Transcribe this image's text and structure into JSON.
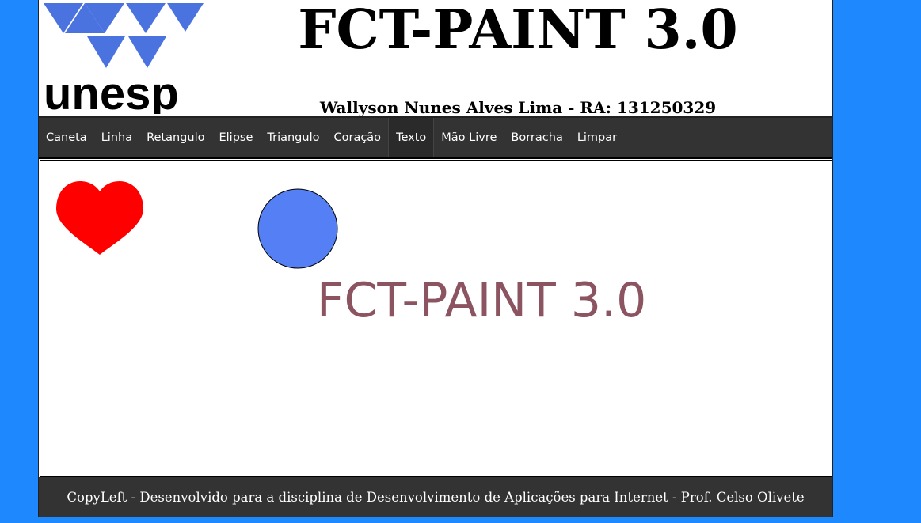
{
  "header": {
    "logo_text": "unesp",
    "title": "FCT-PAINT 3.0",
    "subtitle": "Wallyson Nunes Alves Lima - RA: 131250329"
  },
  "nav": {
    "items": [
      {
        "label": "Caneta"
      },
      {
        "label": "Linha"
      },
      {
        "label": "Retangulo"
      },
      {
        "label": "Elipse"
      },
      {
        "label": "Triangulo"
      },
      {
        "label": "Coração"
      },
      {
        "label": "Texto",
        "active": true
      },
      {
        "label": "Mão Livre"
      },
      {
        "label": "Borracha"
      },
      {
        "label": "Limpar"
      }
    ]
  },
  "canvas": {
    "text": "FCT-PAINT 3.0",
    "shapes": [
      {
        "type": "heart",
        "color": "#ff0000"
      },
      {
        "type": "circle",
        "color": "#5580f5"
      }
    ],
    "text_color": "#8b5460"
  },
  "footer": {
    "text": "CopyLeft - Desenvolvido para a disciplina de Desenvolvimento de Aplicações para Internet - Prof. Celso Olivete"
  },
  "colors": {
    "page_background": "#1e88ff",
    "logo_blue": "#4a73e0",
    "bar_background": "#333333"
  }
}
